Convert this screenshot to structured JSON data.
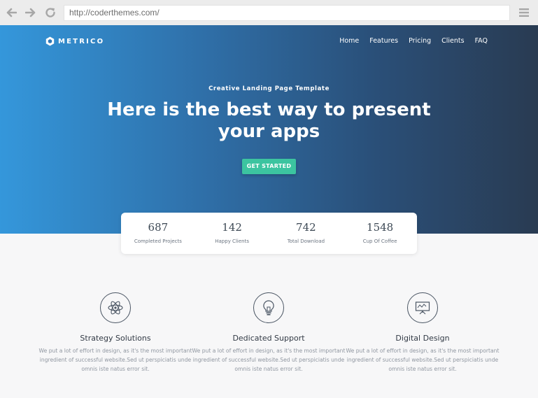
{
  "browser": {
    "url": "http://coderthemes.com/",
    "icons": {
      "back": "arrow-left-icon",
      "forward": "arrow-right-icon",
      "reload": "reload-icon",
      "menu": "hamburger-menu-icon"
    }
  },
  "header": {
    "brand": "METRICO",
    "nav": [
      "Home",
      "Features",
      "Pricing",
      "Clients",
      "FAQ"
    ]
  },
  "hero": {
    "eyebrow": "Creative Landing Page Template",
    "headline_line1": "Here is the best way to present",
    "headline_line2": "your apps",
    "cta": "GET STARTED",
    "gradient": [
      "#3497db",
      "#293b52"
    ],
    "cta_color": "#3cc4a0"
  },
  "stats": [
    {
      "value": "687",
      "label": "Completed Projects"
    },
    {
      "value": "142",
      "label": "Happy Clients"
    },
    {
      "value": "742",
      "label": "Total Download"
    },
    {
      "value": "1548",
      "label": "Cup Of Coffee"
    }
  ],
  "features": [
    {
      "icon": "atom-icon",
      "title": "Strategy Solutions",
      "text": "We put a lot of effort in design, as it's the most important ingredient of successful website.Sed ut perspiciatis unde omnis iste natus error sit."
    },
    {
      "icon": "lightbulb-icon",
      "title": "Dedicated Support",
      "text": "We put a lot of effort in design, as it's the most important ingredient of successful website.Sed ut perspiciatis unde omnis iste natus error sit."
    },
    {
      "icon": "presentation-board-icon",
      "title": "Digital Design",
      "text": "We put a lot of effort in design, as it's the most important ingredient of successful website.Sed ut perspiciatis unde omnis iste natus error sit."
    }
  ]
}
